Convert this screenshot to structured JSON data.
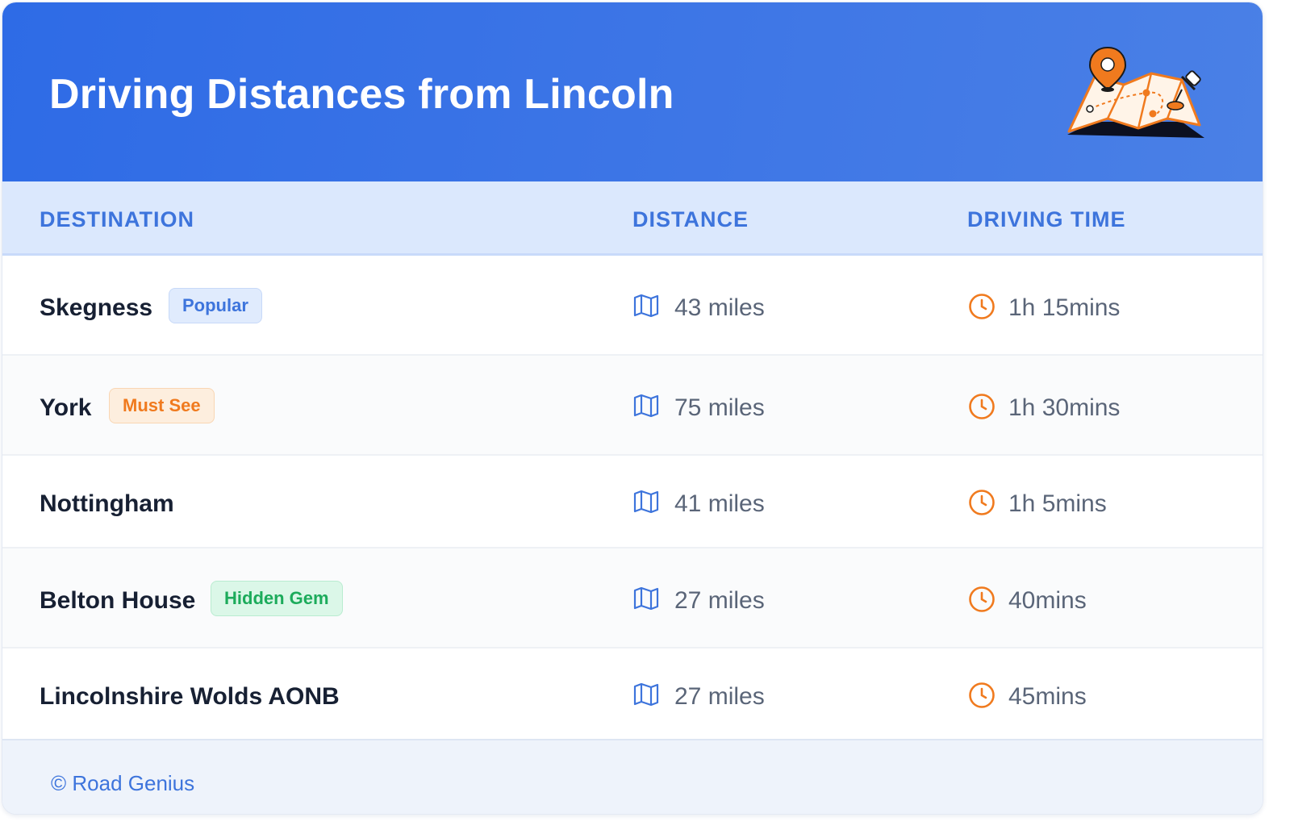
{
  "header": {
    "title": "Driving Distances from Lincoln",
    "illustration_icon": "map-pin-illustration"
  },
  "columns": {
    "destination": "DESTINATION",
    "distance": "DISTANCE",
    "driving_time": "DRIVING TIME"
  },
  "rows": [
    {
      "destination": "Skegness",
      "badge": "Popular",
      "badge_color": "#3d74dc",
      "distance": "43 miles",
      "time": "1h 15mins"
    },
    {
      "destination": "York",
      "badge": "Must See",
      "badge_color": "#f07a1e",
      "distance": "75 miles",
      "time": "1h 30mins"
    },
    {
      "destination": "Nottingham",
      "badge": null,
      "distance": "41 miles",
      "time": "1h 5mins"
    },
    {
      "destination": "Belton House",
      "badge": "Hidden Gem",
      "badge_color": "#1cab5b",
      "distance": "27 miles",
      "time": "40mins"
    },
    {
      "destination": "Lincolnshire Wolds AONB",
      "badge": null,
      "distance": "27 miles",
      "time": "45mins"
    }
  ],
  "icons": {
    "distance": "map-icon",
    "time": "clock-icon"
  },
  "colors": {
    "header_blue": "#2e6be6",
    "accent_blue": "#3d74dc",
    "accent_orange": "#f07a1e",
    "accent_green": "#1cab5b"
  },
  "footer": {
    "copyright": "© Road Genius"
  }
}
